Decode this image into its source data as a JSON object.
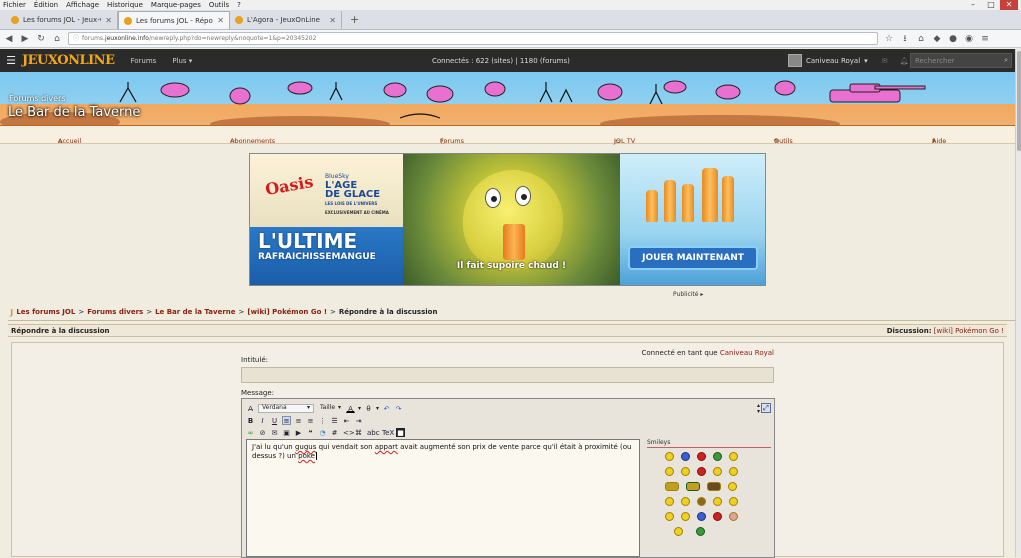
{
  "menubar": [
    "Fichier",
    "Édition",
    "Affichage",
    "Historique",
    "Marque-pages",
    "Outils",
    "?"
  ],
  "tabs": [
    {
      "label": "Les forums JOL - Jeux-vidé...",
      "active": false
    },
    {
      "label": "Les forums JOL - Répondre...",
      "active": true
    },
    {
      "label": "L'Agora - JeuxOnLine",
      "active": false
    }
  ],
  "newtab": "+",
  "url": {
    "prefix": "forums.",
    "domain": "jeuxonline.info",
    "path": "/newreply.php?do=newreply&noquote=1&p=20345202"
  },
  "jol": {
    "logo": "JEUXONLINE",
    "nav_forums": "Forums",
    "nav_plus": "Plus",
    "connected": "Connectés : 622 (sites) | 1180 (forums)",
    "username": "Caniveau Royal",
    "search_placeholder": "Rechercher"
  },
  "banner": {
    "category": "Forums divers",
    "title": "Le Bar de la Taverne"
  },
  "subnav": {
    "home": "Accueil",
    "subs": "Abonnements",
    "forums": "Forums",
    "tv": "JOL TV",
    "tools": "Outils",
    "help": "Aide"
  },
  "ad": {
    "brand": "Oasis",
    "movie_line1": "BlueSky",
    "movie_line2": "L'AGE",
    "movie_line3": "DE GLACE",
    "movie_line4": "LES LOIS DE L'UNIVERS",
    "movie_line5": "EXCLUSIVEMENT AU CINÉMA",
    "slogan_line1": "L'ULTIME",
    "slogan_line2": "RAFRAICHISSEMANGUE",
    "caption": "Il fait supoire chaud !",
    "play_button": "JOUER MAINTENANT",
    "label": "Publicité"
  },
  "breadcrumb": {
    "root": "Les forums JOL",
    "l1": "Forums divers",
    "l2": "Le Bar de la Taverne",
    "l3": "[wiki] Pokémon Go !",
    "current": "Répondre à la discussion",
    "sep": ">"
  },
  "panel": {
    "title": "Répondre à la discussion",
    "discussion_label": "Discussion:",
    "discussion_value": "[wiki] Pokémon Go !",
    "connected_as": "Connecté en tant que",
    "connected_user": "Caniveau Royal",
    "label_title": "Intitulé:",
    "label_message": "Message:"
  },
  "editor": {
    "font": "Verdana",
    "size": "Taille",
    "message_before": "J'ai lu qu'un ",
    "word1": "gugus",
    "message_mid1": " qui vendait son ",
    "word2": "appart",
    "message_mid2": " avait augmenté son prix de vente parce qu'il était à proximité (ou dessus ?) un ",
    "word3": "poke",
    "smileys_label": "Smileys"
  },
  "colors": {
    "jolbar": "#2b2b2b",
    "accent": "#f3a81c",
    "link": "#8a2010"
  }
}
